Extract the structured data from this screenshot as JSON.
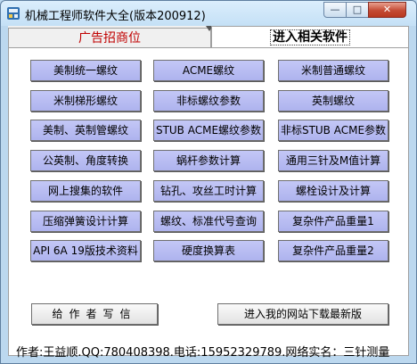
{
  "window": {
    "title": "机械工程师软件大全(版本200912)"
  },
  "titlebar_buttons": {
    "minimize": "—",
    "maximize": "□",
    "close": "✕"
  },
  "tabs": [
    {
      "label": "广告招商位"
    },
    {
      "label": "进入相关软件"
    }
  ],
  "buttons": [
    [
      "美制统一螺纹",
      "ACME螺纹",
      "米制普通螺纹"
    ],
    [
      "米制梯形螺纹",
      "非标螺纹参数",
      "英制螺纹"
    ],
    [
      "美制、英制管螺纹",
      "STUB ACME螺纹参数",
      "非标STUB ACME参数"
    ],
    [
      "公英制、角度转换",
      "蜗杆参数计算",
      "通用三针及M值计算"
    ],
    [
      "网上搜集的软件",
      "钻孔、攻丝工时计算",
      "螺栓设计及计算"
    ],
    [
      "压缩弹簧设计计算",
      "螺纹、标准代号查询",
      "复杂件产品重量1"
    ],
    [
      "API 6A 19版技术资料",
      "硬度换算表",
      "复杂件产品重量2"
    ]
  ],
  "bottom": {
    "write_to_author": "给作者写信",
    "download_site": "进入我的网站下载最新版"
  },
  "footer": {
    "text": "作者:王益顺.QQ:780408398.电话:15952329789.网络实名：三针测量"
  },
  "colors": {
    "button_fill": "#b7bbf2",
    "ad_tab_text": "#c00000",
    "window_frame": "#bcd8ef"
  }
}
